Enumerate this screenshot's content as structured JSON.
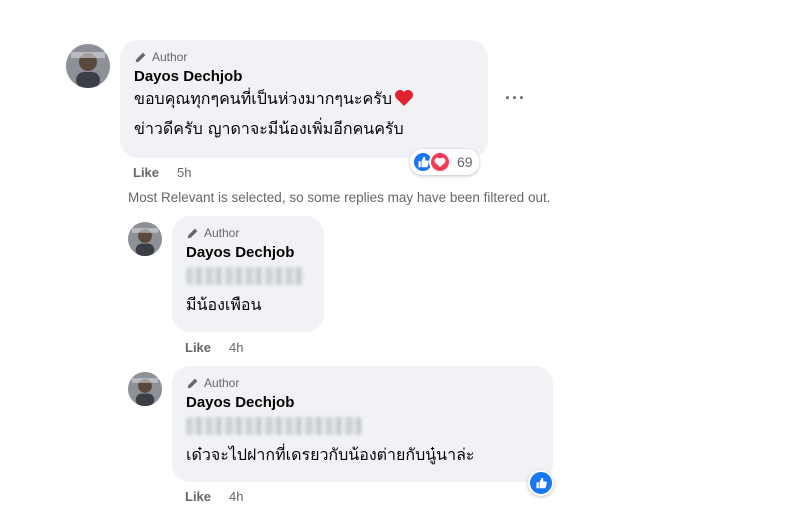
{
  "comments": [
    {
      "author_tag": "Author",
      "name": "Dayos Dechjob",
      "lines": [
        "ขอบคุณทุกๆคนที่เป็นห่วงมากๆนะครับ",
        "ข่าวดีครับ ญาดาจะมีน้องเพิ่มอีกคนครับ"
      ],
      "like_label": "Like",
      "time": "5h",
      "reaction_count": "69",
      "more_label": "···"
    }
  ],
  "filter_note": "Most Relevant is selected, so some replies may have been filtered out.",
  "replies": [
    {
      "author_tag": "Author",
      "name": "Dayos Dechjob",
      "text": "มีน้องเพือน",
      "like_label": "Like",
      "time": "4h"
    },
    {
      "author_tag": "Author",
      "name": "Dayos Dechjob",
      "text": "เด๋วจะไปฝากที่เดรยวกับน้องต่ายกับนู๋นาล่ะ",
      "like_label": "Like",
      "time": "4h"
    }
  ],
  "colors": {
    "like_blue": "#1877f2",
    "love_red": "#f33e58",
    "bubble": "#f0f2f5",
    "meta_gray": "#65676b"
  },
  "icons": {
    "author": "pencil-icon",
    "reaction_like": "thumbs-up-icon",
    "reaction_love": "heart-icon"
  }
}
